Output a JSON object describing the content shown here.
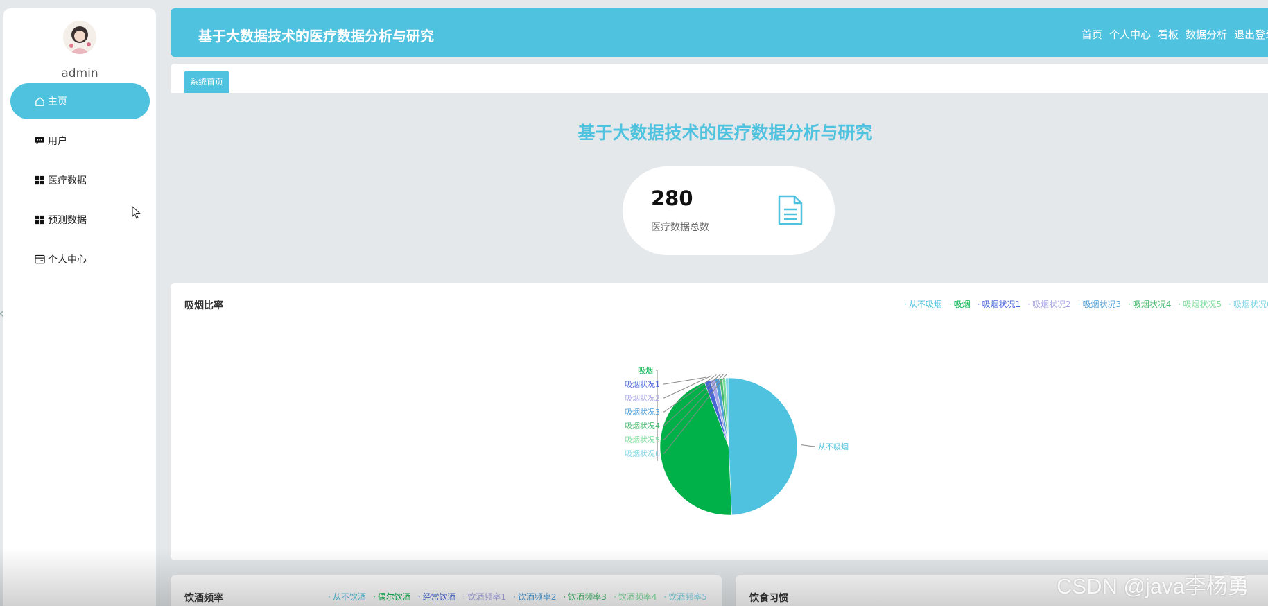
{
  "sidebar": {
    "username": "admin",
    "items": [
      {
        "label": "主页",
        "icon": "home-icon",
        "active": true
      },
      {
        "label": "用户",
        "icon": "chat-icon"
      },
      {
        "label": "医疗数据",
        "icon": "grid-icon"
      },
      {
        "label": "预测数据",
        "icon": "grid-icon"
      },
      {
        "label": "个人中心",
        "icon": "card-icon"
      }
    ]
  },
  "header": {
    "title": "基于大数据技术的医疗数据分析与研究",
    "links": [
      "首页",
      "个人中心",
      "看板",
      "数据分析",
      "退出登录"
    ]
  },
  "tabs": {
    "active": "系统首页"
  },
  "page": {
    "title": "基于大数据技术的医疗数据分析与研究"
  },
  "stat": {
    "value": "280",
    "label": "医疗数据总数"
  },
  "smoking_panel": {
    "title": "吸烟比率"
  },
  "drinking_panel": {
    "title": "饮酒频率",
    "legend": [
      "从不饮酒",
      "偶尔饮酒",
      "经常饮酒",
      "饮酒频率1",
      "饮酒频率2",
      "饮酒频率3",
      "饮酒频率4",
      "饮酒频率5"
    ]
  },
  "diet_panel": {
    "title": "饮食习惯"
  },
  "watermark": "CSDN @java李杨勇",
  "colors": {
    "accent": "#4fc2df",
    "green": "#00b14a"
  },
  "chart_data": {
    "type": "pie",
    "title": "吸烟比率",
    "legend_position": "top-right",
    "categories": [
      "从不吸烟",
      "吸烟",
      "吸烟状况1",
      "吸烟状况2",
      "吸烟状况3",
      "吸烟状况4",
      "吸烟状况5",
      "吸烟状况6"
    ],
    "values": [
      138,
      126,
      4,
      3,
      3,
      2,
      2,
      2
    ],
    "colors": [
      "#4fc2df",
      "#00b14a",
      "#4866d6",
      "#a8a6e6",
      "#4f9ed8",
      "#46b96d",
      "#7cdc9a",
      "#7fd6e6"
    ]
  }
}
